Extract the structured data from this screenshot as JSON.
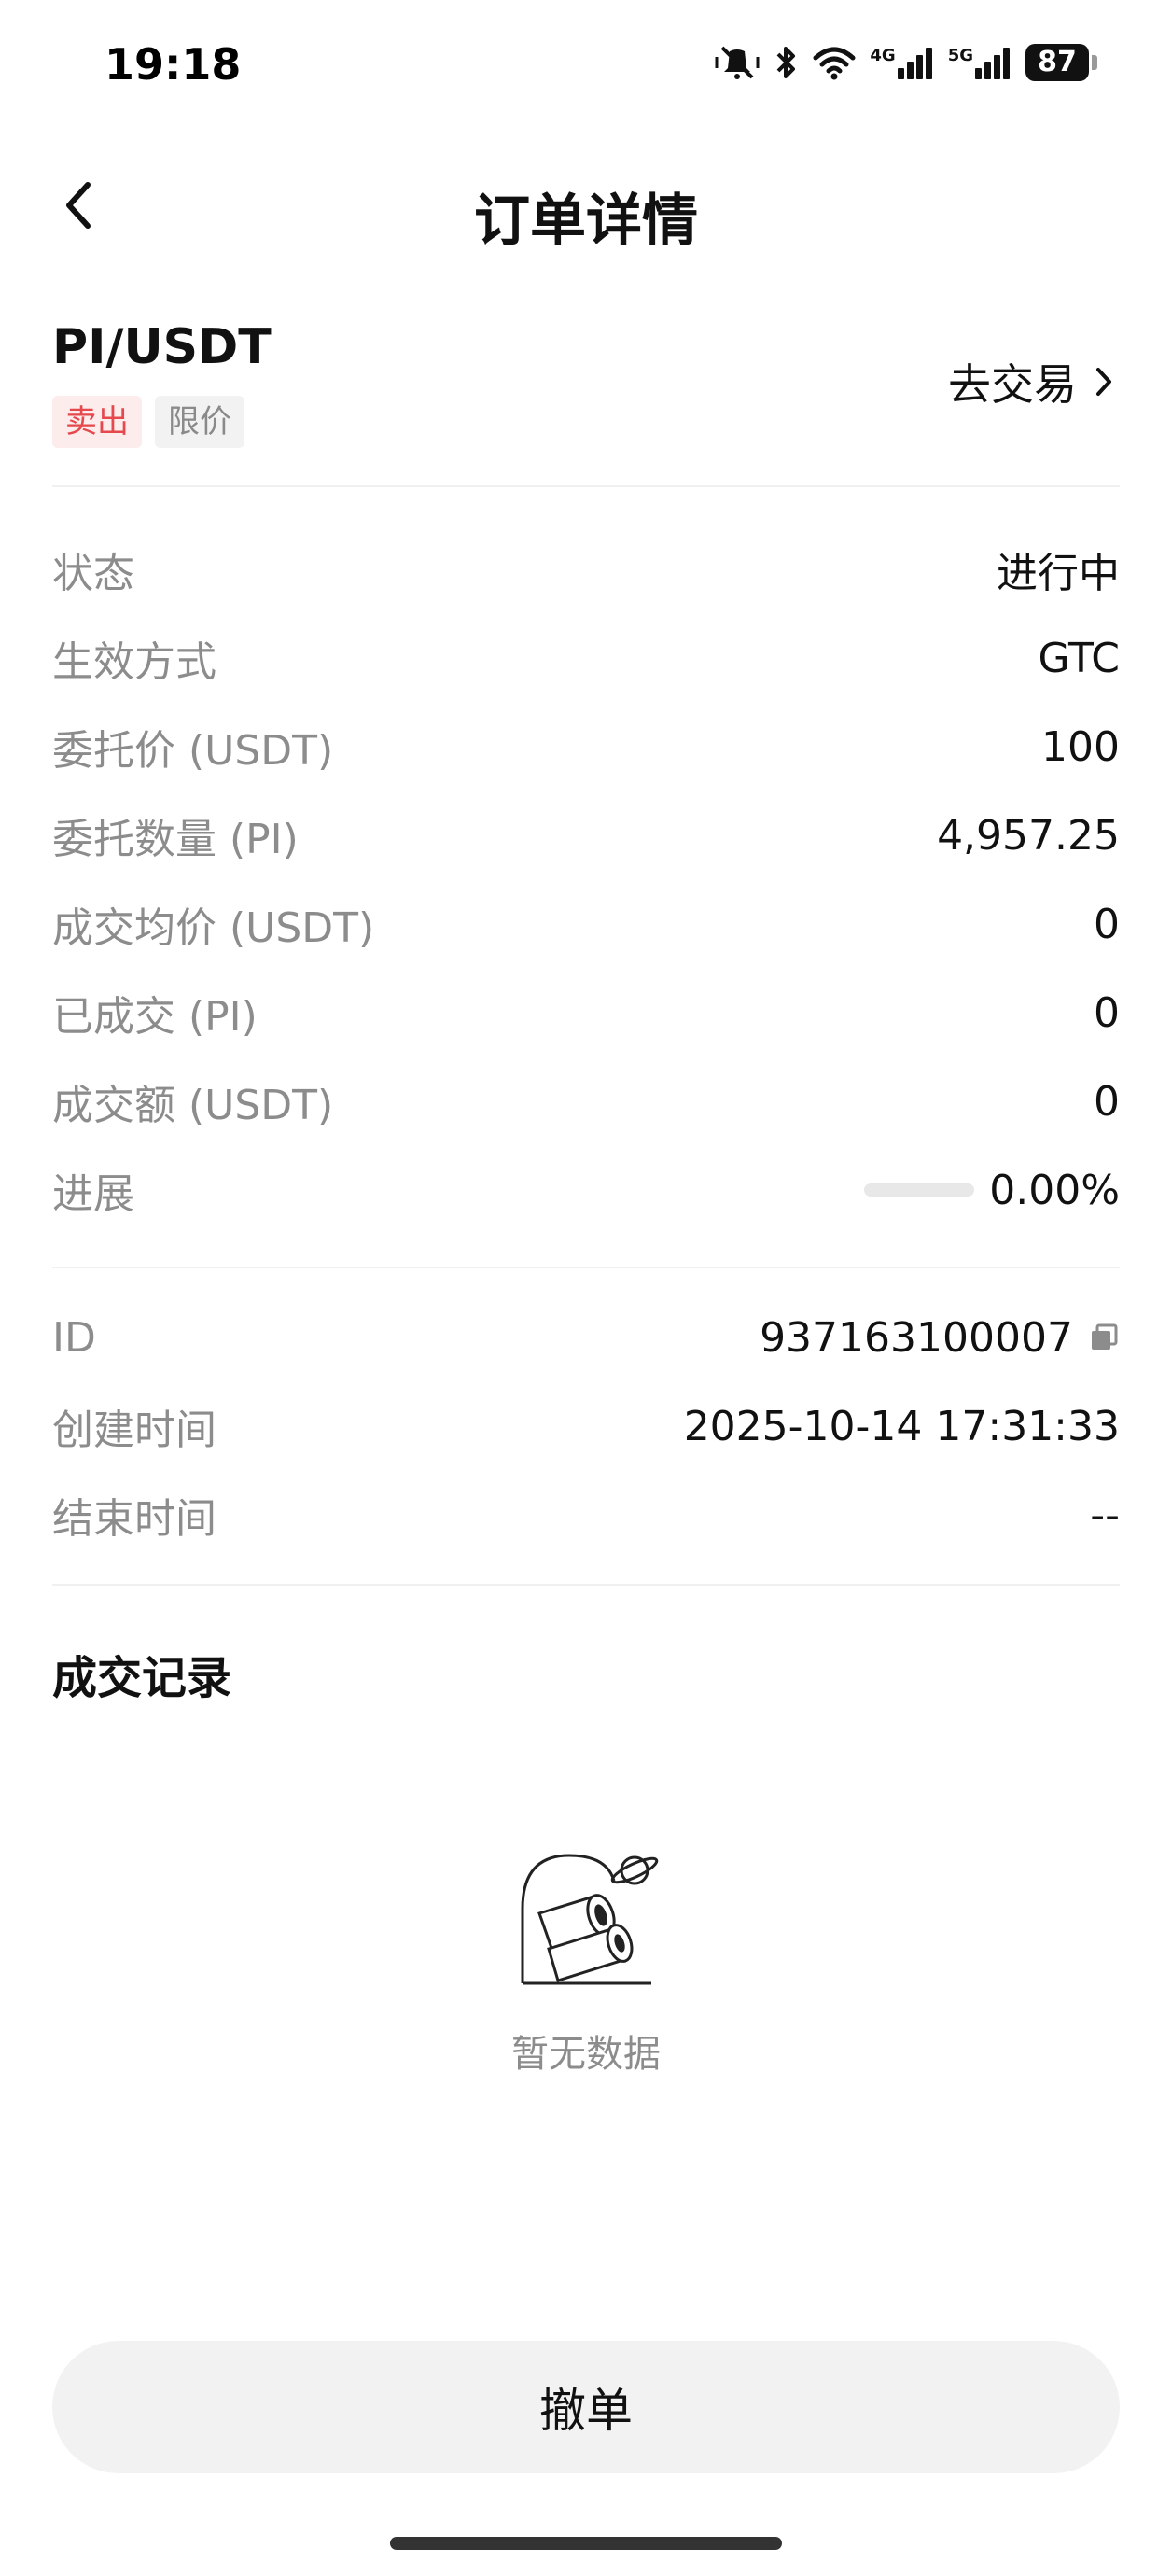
{
  "status_bar": {
    "time": "19:18",
    "network_4g": "4G",
    "network_5g": "5G",
    "battery": "87",
    "icons": [
      "mute-icon",
      "bluetooth-icon",
      "wifi-icon",
      "signal-icon",
      "battery-icon"
    ]
  },
  "header": {
    "title": "订单详情",
    "back_icon": "chevron-left-icon"
  },
  "order": {
    "pair": "PI/USDT",
    "side_tag": "卖出",
    "type_tag": "限价",
    "trade_link": "去交易"
  },
  "details": [
    {
      "label": "状态",
      "value": "进行中"
    },
    {
      "label": "生效方式",
      "value": "GTC"
    },
    {
      "label": "委托价 (USDT)",
      "value": "100"
    },
    {
      "label": "委托数量 (PI)",
      "value": "4,957.25"
    },
    {
      "label": "成交均价 (USDT)",
      "value": "0"
    },
    {
      "label": "已成交 (PI)",
      "value": "0"
    },
    {
      "label": "成交额 (USDT)",
      "value": "0"
    }
  ],
  "progress": {
    "label": "进展",
    "value": "0.00%",
    "fraction": 0
  },
  "meta": [
    {
      "label": "ID",
      "value": "937163100007"
    },
    {
      "label": "创建时间",
      "value": "2025-10-14 17:31:33"
    },
    {
      "label": "结束时间",
      "value": "--"
    }
  ],
  "records": {
    "title": "成交记录",
    "empty_text": "暂无数据"
  },
  "actions": {
    "cancel_label": "撤单"
  },
  "colors": {
    "sell": "#e5484d",
    "sell_bg": "#fdecec",
    "muted": "#8c8c8c",
    "button_bg": "#f2f2f2"
  }
}
